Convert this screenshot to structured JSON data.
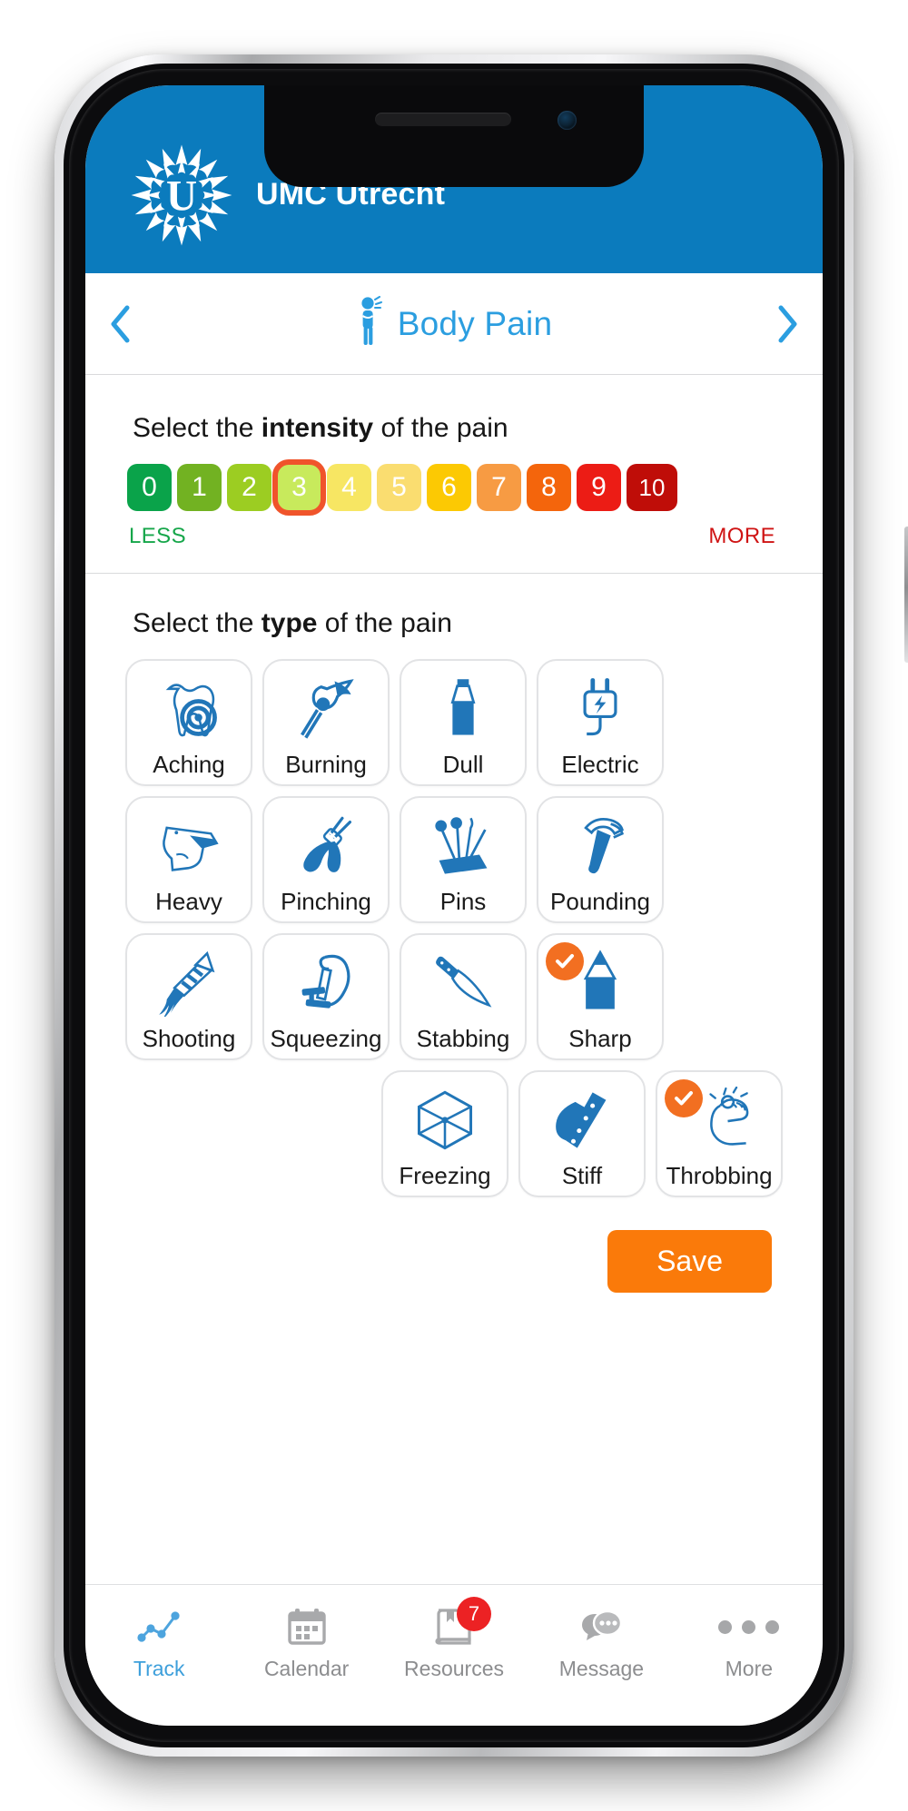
{
  "app": {
    "brand": "UMC Utrecht",
    "brand_color": "#0b7bbd",
    "logo_icon": "umc-sunburst-logo-icon"
  },
  "nav": {
    "back_icon": "chevron-left-icon",
    "forward_icon": "chevron-right-icon",
    "title": "Body Pain",
    "title_icon": "person-in-pain-icon",
    "title_color": "#2b9ee0"
  },
  "intensity": {
    "heading_prefix": "Select the ",
    "heading_emphasis": "intensity",
    "heading_suffix": " of the pain",
    "selected_value": "3",
    "selection_outline_color": "#f0542b",
    "legend_less": "LESS",
    "legend_more": "MORE",
    "legend_less_color": "#16a64a",
    "legend_more_color": "#cf1414",
    "scale": [
      {
        "value": "0",
        "color": "#0aa34a"
      },
      {
        "value": "1",
        "color": "#72b222"
      },
      {
        "value": "2",
        "color": "#9ccd22"
      },
      {
        "value": "3",
        "color": "#c8ea5c"
      },
      {
        "value": "4",
        "color": "#f7e663"
      },
      {
        "value": "5",
        "color": "#fadd70"
      },
      {
        "value": "6",
        "color": "#fcc903"
      },
      {
        "value": "7",
        "color": "#f79b43"
      },
      {
        "value": "8",
        "color": "#f4650c"
      },
      {
        "value": "9",
        "color": "#ec1c15"
      },
      {
        "value": "10",
        "color": "#bf0d08"
      }
    ]
  },
  "pain_type": {
    "heading_prefix": "Select the ",
    "heading_emphasis": "type",
    "heading_suffix": " of the pain",
    "check_badge_color": "#f26f21",
    "icon_color": "#2176b8",
    "rows": [
      [
        {
          "label": "Aching",
          "icon": "tooth-target-icon",
          "selected": false
        },
        {
          "label": "Burning",
          "icon": "match-flame-icon",
          "selected": false
        },
        {
          "label": "Dull",
          "icon": "blunt-pencil-icon",
          "selected": false
        },
        {
          "label": "Electric",
          "icon": "plug-bolt-icon",
          "selected": false
        }
      ],
      [
        {
          "label": "Heavy",
          "icon": "anvil-icon",
          "selected": false
        },
        {
          "label": "Pinching",
          "icon": "pliers-icon",
          "selected": false
        },
        {
          "label": "Pins",
          "icon": "pins-needles-icon",
          "selected": false
        },
        {
          "label": "Pounding",
          "icon": "hammer-icon",
          "selected": false
        }
      ],
      [
        {
          "label": "Shooting",
          "icon": "firework-rocket-icon",
          "selected": false
        },
        {
          "label": "Squeezing",
          "icon": "clamp-vise-icon",
          "selected": false
        },
        {
          "label": "Stabbing",
          "icon": "knife-icon",
          "selected": false
        },
        {
          "label": "Sharp",
          "icon": "sharp-pencil-icon",
          "selected": true
        }
      ],
      [
        {
          "label": "Freezing",
          "icon": "ice-cube-icon",
          "selected": false
        },
        {
          "label": "Stiff",
          "icon": "stiff-board-icon",
          "selected": false
        },
        {
          "label": "Throbbing",
          "icon": "throbbing-foot-icon",
          "selected": true
        }
      ]
    ]
  },
  "actions": {
    "save_label": "Save",
    "save_color": "#fa7a0a"
  },
  "tabbar": {
    "items": [
      {
        "label": "Track",
        "icon": "line-chart-icon",
        "active": true,
        "badge": ""
      },
      {
        "label": "Calendar",
        "icon": "calendar-icon",
        "active": false,
        "badge": ""
      },
      {
        "label": "Resources",
        "icon": "book-icon",
        "active": false,
        "badge": "7"
      },
      {
        "label": "Message",
        "icon": "chat-bubbles-icon",
        "active": false,
        "badge": ""
      },
      {
        "label": "More",
        "icon": "ellipsis-icon",
        "active": false,
        "badge": ""
      }
    ],
    "badge_color": "#ec2224",
    "active_color": "#3d9fdb",
    "inactive_color": "#8c8d8f"
  }
}
